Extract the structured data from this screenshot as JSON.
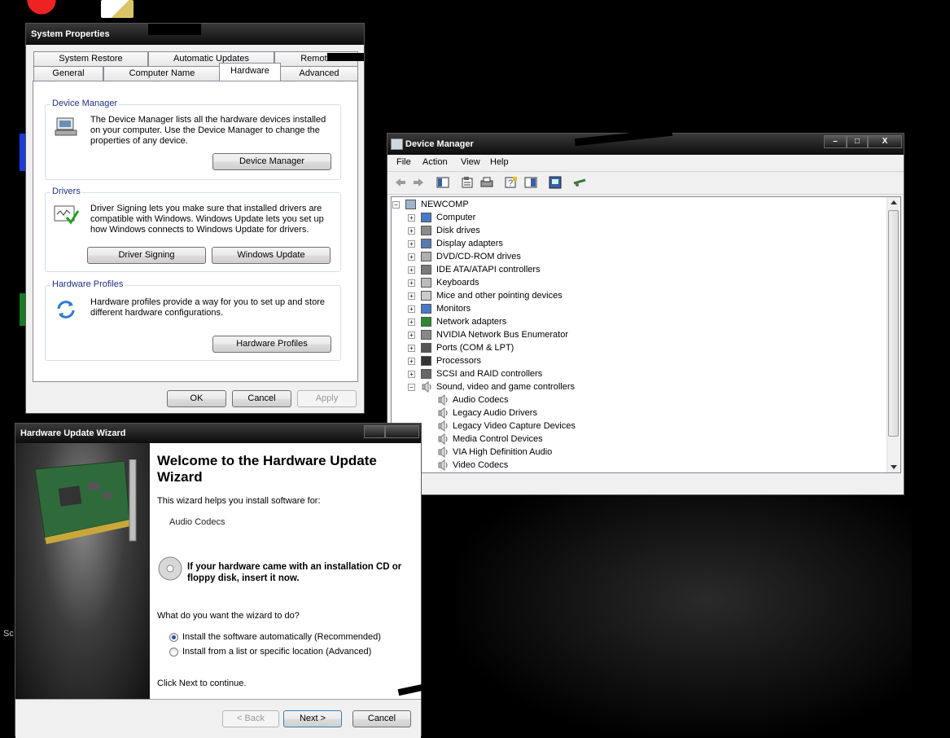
{
  "colors": {
    "accent_blue": "#1e3287",
    "titlebar": "#1a1a1a",
    "window_bg": "#f0f0f0"
  },
  "system_properties": {
    "title": "System Properties",
    "tabs_row1": [
      "System Restore",
      "Automatic Updates",
      "Remote"
    ],
    "tabs_row2": [
      "General",
      "Computer Name",
      "Hardware",
      "Advanced"
    ],
    "active_tab": "Hardware",
    "device_manager": {
      "title": "Device Manager",
      "text": "The Device Manager lists all the hardware devices installed on your computer. Use the Device Manager to change the properties of any device.",
      "button": "Device Manager"
    },
    "drivers": {
      "title": "Drivers",
      "text": "Driver Signing lets you make sure that installed drivers are compatible with Windows. Windows Update lets you set up how Windows connects to Windows Update for drivers.",
      "button_signing": "Driver Signing",
      "button_update": "Windows Update"
    },
    "hardware_profiles": {
      "title": "Hardware Profiles",
      "text": "Hardware profiles provide a way for you to set up and store different hardware configurations.",
      "button": "Hardware Profiles"
    },
    "ok": "OK",
    "cancel": "Cancel",
    "apply": "Apply"
  },
  "device_manager": {
    "title": "Device Manager",
    "caption_buttons": {
      "minimize": "–",
      "maximize": "□",
      "close": "X"
    },
    "menu": [
      "File",
      "Action",
      "View",
      "Help"
    ],
    "toolbar_icons": [
      "back-icon",
      "forward-icon",
      "properties-icon",
      "scan-icon",
      "print-icon",
      "help-icon",
      "console-tree-icon",
      "update-driver-icon",
      "network-icon"
    ],
    "root": "NEWCOMP",
    "categories": [
      "Computer",
      "Disk drives",
      "Display adapters",
      "DVD/CD-ROM drives",
      "IDE ATA/ATAPI controllers",
      "Keyboards",
      "Mice and other pointing devices",
      "Monitors",
      "Network adapters",
      "NVIDIA Network Bus Enumerator",
      "Ports (COM & LPT)",
      "Processors",
      "SCSI and RAID controllers",
      "Sound, video and game controllers"
    ],
    "sound_children": [
      "Audio Codecs",
      "Legacy Audio Drivers",
      "Legacy Video Capture Devices",
      "Media Control Devices",
      "VIA High Definition Audio",
      "Video Codecs"
    ]
  },
  "wizard": {
    "title": "Hardware Update Wizard",
    "heading": "Welcome to the Hardware Update Wizard",
    "intro": "This wizard helps you install software for:",
    "device": "Audio Codecs",
    "cd_note": "If your hardware came with an installation CD or floppy disk, insert it now.",
    "question": "What do you want the wizard to do?",
    "option_auto": "Install the software automatically (Recommended)",
    "option_list": "Install from a list or specific location (Advanced)",
    "selected_option": "auto",
    "continue": "Click Next to continue.",
    "back": "< Back",
    "next": "Next >",
    "cancel": "Cancel"
  },
  "desktop": {
    "label_partial": "Sc"
  }
}
